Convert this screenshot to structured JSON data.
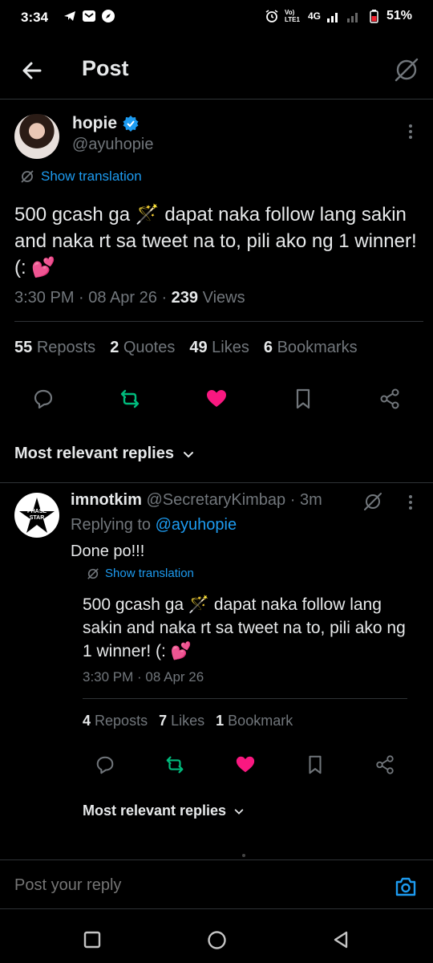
{
  "status_bar": {
    "time": "3:34",
    "network": "4G",
    "battery": "51%",
    "volte": "Vo) LTE1"
  },
  "header": {
    "title": "Post"
  },
  "post": {
    "author_name": "hopie",
    "handle": "@ayuhopie",
    "show_translation": "Show translation",
    "text": "500 gcash ga 🪄 dapat naka follow lang sakin and naka rt sa tweet na to, pili ako ng 1 winner! (: 💕",
    "time": "3:30 PM",
    "date": "08 Apr 26",
    "views_count": "239",
    "views_label": "Views",
    "stats": {
      "reposts_count": "55",
      "reposts_label": "Reposts",
      "quotes_count": "2",
      "quotes_label": "Quotes",
      "likes_count": "49",
      "likes_label": "Likes",
      "bookmarks_count": "6",
      "bookmarks_label": "Bookmarks"
    }
  },
  "sort": {
    "label": "Most relevant replies"
  },
  "reply": {
    "author_name": "imnotkim",
    "handle": "@SecretaryKimbap",
    "time_ago": "3m",
    "replying_to_label": "Replying to",
    "replying_to_handle": "@ayuhopie",
    "avatar_text": "PHASE STAR",
    "text": "Done po!!!",
    "show_translation": "Show translation",
    "quoted_text": "500 gcash ga 🪄 dapat naka follow lang sakin and naka rt sa tweet na to, pili ako ng 1 winner! (: 💕",
    "quoted_time": "3:30 PM",
    "quoted_date": "08 Apr 26",
    "stats": {
      "reposts_count": "4",
      "reposts_label": "Reposts",
      "likes_count": "7",
      "likes_label": "Likes",
      "bookmarks_count": "1",
      "bookmarks_label": "Bookmark"
    },
    "sort_label": "Most relevant replies"
  },
  "compose": {
    "placeholder": "Post your reply"
  },
  "colors": {
    "accent": "#1d9bf0",
    "repost": "#00ba7c",
    "like": "#f91880",
    "muted": "#71767b",
    "background": "#000000"
  }
}
